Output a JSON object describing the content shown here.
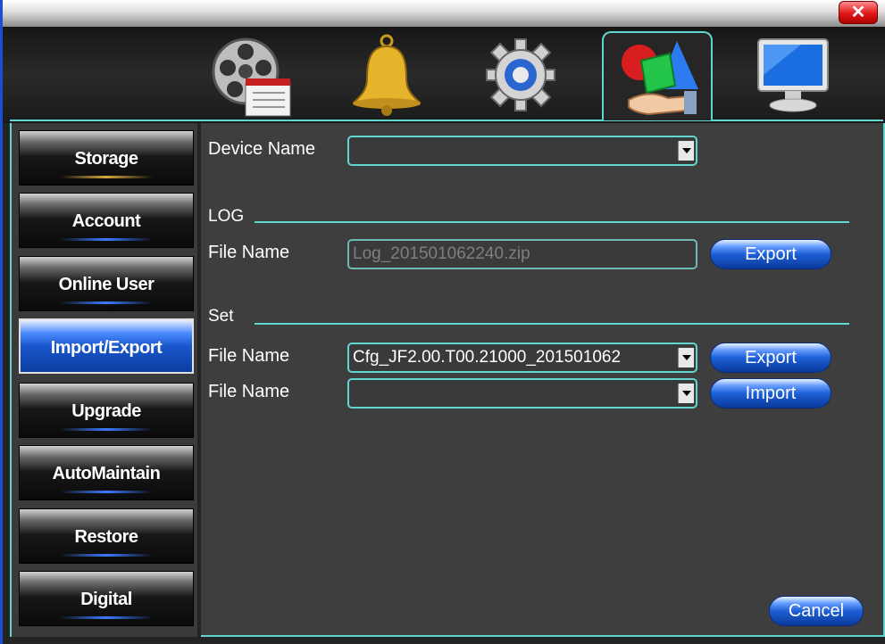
{
  "window": {
    "close_glyph": "✕"
  },
  "tabs": [
    {
      "icon": "film-reel-icon",
      "active": false
    },
    {
      "icon": "bell-icon",
      "active": false
    },
    {
      "icon": "gear-icon",
      "active": false
    },
    {
      "icon": "shapes-tools-icon",
      "active": true
    },
    {
      "icon": "monitor-icon",
      "active": false
    }
  ],
  "sidebar": {
    "items": [
      {
        "label": "Storage"
      },
      {
        "label": "Account"
      },
      {
        "label": "Online User"
      },
      {
        "label": "Import/Export",
        "active": true
      },
      {
        "label": "Upgrade"
      },
      {
        "label": "AutoMaintain"
      },
      {
        "label": "Restore"
      },
      {
        "label": "Digital"
      }
    ]
  },
  "form": {
    "device_name_label": "Device Name",
    "device_name_value": "",
    "log_section": {
      "title": "LOG",
      "file_label": "File Name",
      "file_value": "Log_201501062240.zip",
      "export_label": "Export"
    },
    "set_section": {
      "title": "Set",
      "export_file_label": "File Name",
      "export_file_value": "Cfg_JF2.00.T00.21000_201501062",
      "export_label": "Export",
      "import_file_label": "File Name",
      "import_file_value": "",
      "import_label": "Import"
    },
    "cancel_label": "Cancel"
  },
  "colors": {
    "accent": "#5fd7cf",
    "button_blue": "#1d5fd6",
    "close_red": "#e01818"
  }
}
